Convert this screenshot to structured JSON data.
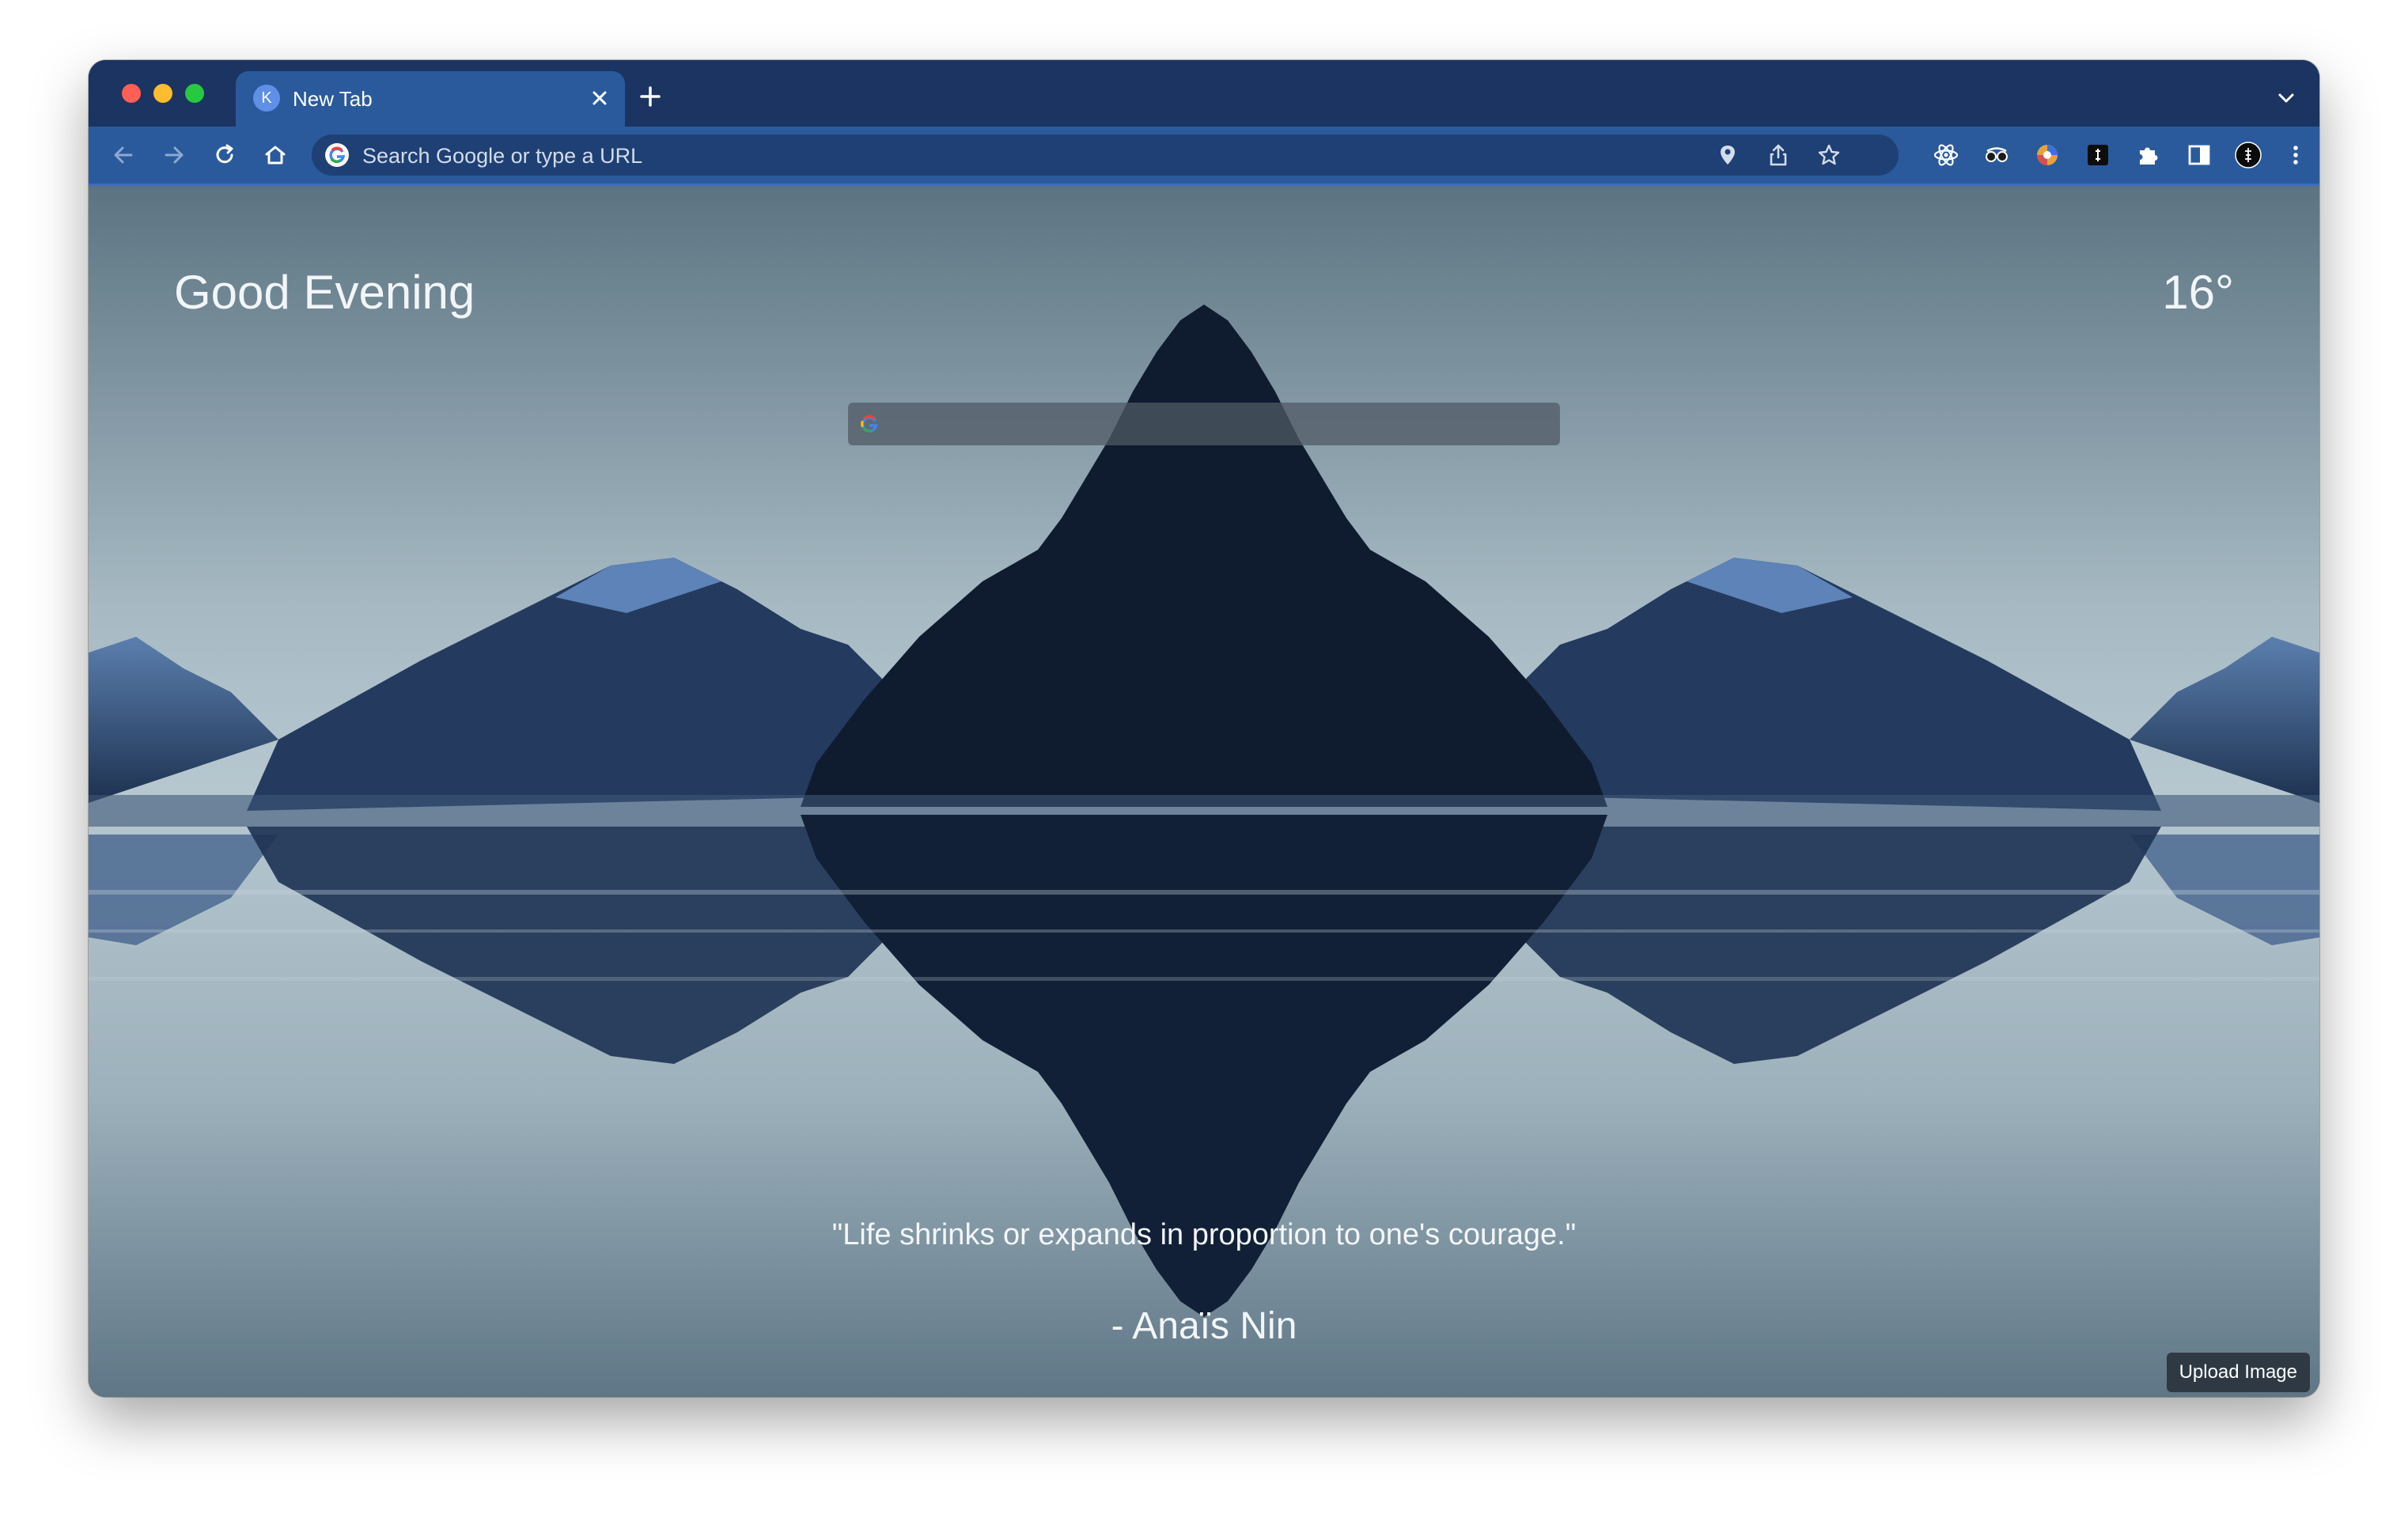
{
  "tab": {
    "favicon_letter": "K",
    "title": "New Tab"
  },
  "omnibox": {
    "placeholder": "Search Google or type a URL"
  },
  "icons": {
    "back": "arrow-left-icon",
    "forward": "arrow-right-icon",
    "reload": "reload-icon",
    "home": "home-icon",
    "location": "location-pin-icon",
    "share": "share-icon",
    "bookmark": "star-icon",
    "extensions": [
      "atom-icon",
      "spy-glasses-icon",
      "colorful-orb-icon",
      "brave-logo-icon",
      "puzzle-icon",
      "side-panel-icon"
    ],
    "profile": "profile-avatar-icon",
    "menu": "kebab-menu-icon"
  },
  "page": {
    "greeting": "Good Evening",
    "temperature": "16°",
    "quote": "\"Life shrinks or expands in proportion to one's courage.\"",
    "author": "- Anaïs Nin",
    "upload_label": "Upload Image"
  },
  "colors": {
    "frame": "#1b3461",
    "toolbar": "#2a5a9c",
    "omnibox": "#1e4074",
    "mountain": "#0f1c30"
  }
}
